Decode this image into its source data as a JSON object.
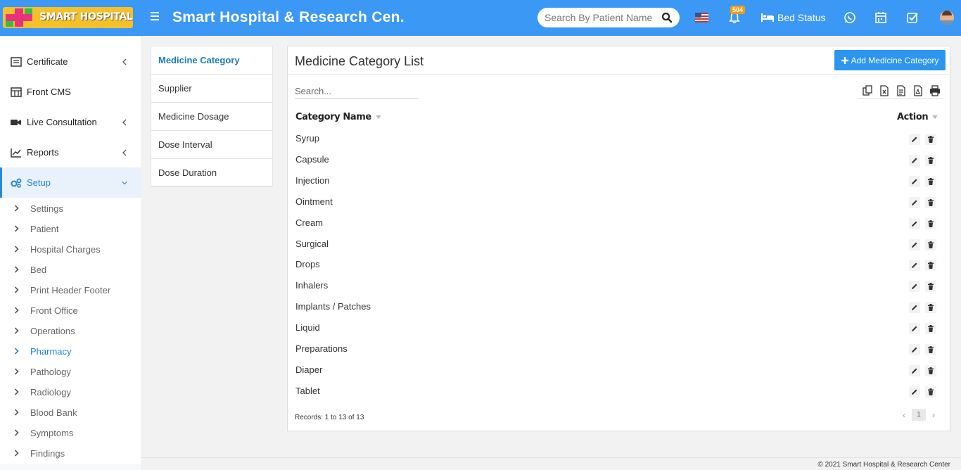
{
  "header": {
    "logo_text": "SMART HOSPITAL",
    "title": "Smart Hospital & Research Cen...",
    "search_placeholder": "Search By Patient Name",
    "notification_count": "504",
    "bed_status_label": "Bed Status",
    "brand_color": "#3b98f5"
  },
  "sidebar": {
    "items": [
      {
        "label": "Certificate",
        "icon": "certificate-icon"
      },
      {
        "label": "Front CMS",
        "icon": "cms-icon"
      },
      {
        "label": "Live Consultation",
        "icon": "video-icon"
      },
      {
        "label": "Reports",
        "icon": "chart-line-icon"
      },
      {
        "label": "Setup",
        "icon": "gears-icon"
      }
    ],
    "setup_submenu": [
      "Settings",
      "Patient",
      "Hospital Charges",
      "Bed",
      "Print Header Footer",
      "Front Office",
      "Operations",
      "Pharmacy",
      "Pathology",
      "Radiology",
      "Blood Bank",
      "Symptoms",
      "Findings"
    ],
    "active_submenu": "Pharmacy"
  },
  "tabs": [
    "Medicine Category",
    "Supplier",
    "Medicine Dosage",
    "Dose Interval",
    "Dose Duration"
  ],
  "panel": {
    "title": "Medicine Category List",
    "add_button_label": "Add Medicine Category",
    "search_placeholder": "Search...",
    "columns": [
      "Category Name",
      "Action"
    ],
    "rows": [
      "Syrup",
      "Capsule",
      "Injection",
      "Ointment",
      "Cream",
      "Surgical",
      "Drops",
      "Inhalers",
      "Implants / Patches",
      "Liquid",
      "Preparations",
      "Diaper",
      "Tablet"
    ],
    "records_text": "Records: 1 to 13 of 13",
    "current_page": "1"
  },
  "footer": {
    "copyright": "© 2021 Smart Hospital & Research Center"
  }
}
